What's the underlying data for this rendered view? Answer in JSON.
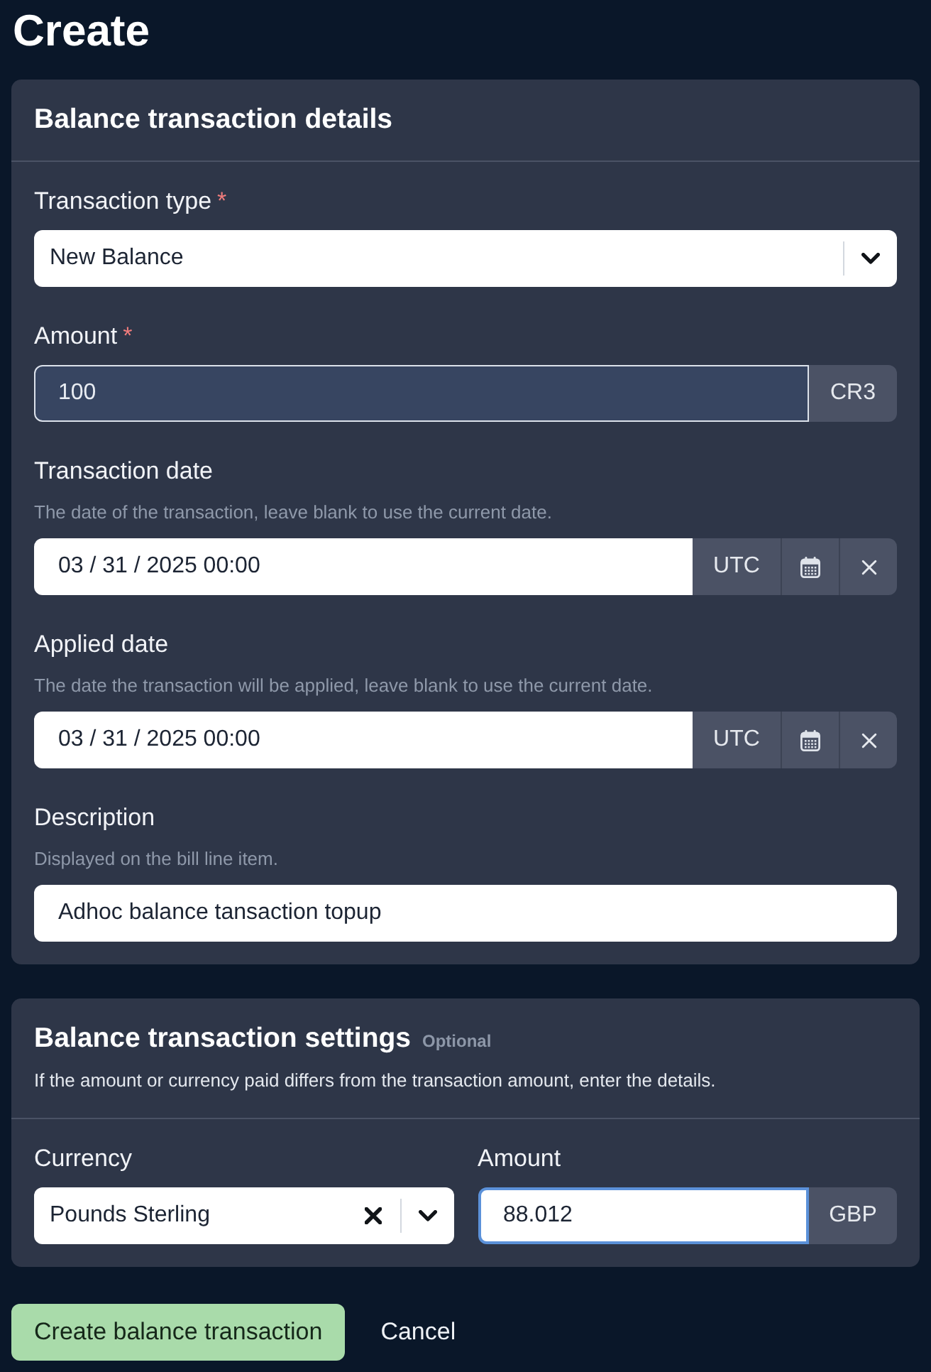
{
  "page": {
    "title": "Create"
  },
  "sections": [
    {
      "title": "Balance transaction details",
      "rows": [
        [
          {
            "kind": "select",
            "label": "Transaction type",
            "required_mark": "*",
            "value": "New Balance",
            "clearable": false,
            "focused": false,
            "autofilled": false
          }
        ],
        [
          {
            "kind": "amount",
            "label": "Amount",
            "required_mark": "*",
            "value": "100",
            "unit": "CR3",
            "focused": false,
            "autofilled": true
          }
        ],
        [
          {
            "kind": "date",
            "label": "Transaction date",
            "hint": "The date of the transaction, leave blank to use the current date.",
            "value": "03 / 31 / 2025 00:00",
            "timezone": "UTC",
            "focused": false,
            "autofilled": false
          }
        ],
        [
          {
            "kind": "date",
            "label": "Applied date",
            "hint": "The date the transaction will be applied, leave blank to use the current date.",
            "value": "03 / 31 / 2025 00:00",
            "timezone": "UTC",
            "focused": false,
            "autofilled": false
          }
        ],
        [
          {
            "kind": "text",
            "label": "Description",
            "hint": "Displayed on the bill line item.",
            "value": "Adhoc balance tansaction topup",
            "focused": false,
            "autofilled": false
          }
        ]
      ]
    },
    {
      "title": "Balance transaction settings",
      "tag": "Optional",
      "description": "If the amount or currency paid differs from the transaction amount, enter the details.",
      "rows": [
        [
          {
            "kind": "select",
            "label": "Currency",
            "value": "Pounds Sterling",
            "clearable": true,
            "focused": false,
            "autofilled": false
          },
          {
            "kind": "amount",
            "label": "Amount",
            "value": "88.012",
            "unit": "GBP",
            "focused": true,
            "autofilled": false
          }
        ]
      ]
    }
  ],
  "actions": [
    {
      "kind": "primary",
      "label": "Create balance transaction"
    },
    {
      "kind": "link",
      "label": "Cancel"
    }
  ]
}
